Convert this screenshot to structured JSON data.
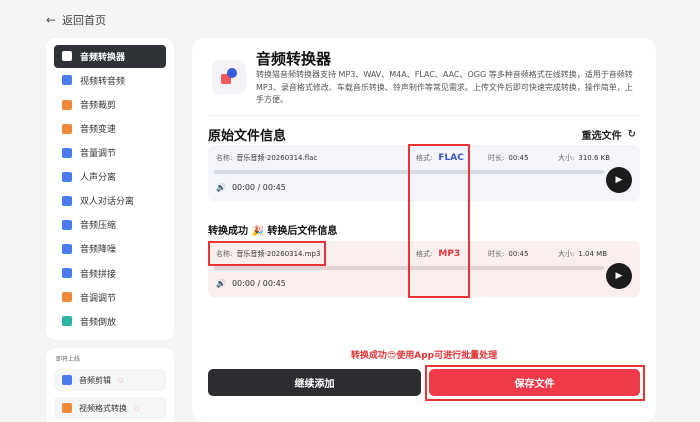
{
  "nav": {
    "back_label": "返回首页"
  },
  "sidebar": {
    "items": [
      {
        "label": "音频转换器",
        "icon": "audio-convert-icon",
        "color": "#3a5bd9",
        "active": true
      },
      {
        "label": "视频转音频",
        "icon": "video-audio-icon",
        "color": "#4a7cf0"
      },
      {
        "label": "音频裁剪",
        "icon": "scissors-icon",
        "color": "#f08a3a"
      },
      {
        "label": "音频变速",
        "icon": "speed-icon",
        "color": "#f08a3a"
      },
      {
        "label": "音量调节",
        "icon": "volume-icon",
        "color": "#4a7cf0"
      },
      {
        "label": "人声分离",
        "icon": "vocal-icon",
        "color": "#4a7cf0"
      },
      {
        "label": "双人对话分离",
        "icon": "dialog-icon",
        "color": "#4a7cf0"
      },
      {
        "label": "音频压缩",
        "icon": "compress-icon",
        "color": "#4a7cf0"
      },
      {
        "label": "音频降噪",
        "icon": "denoise-icon",
        "color": "#4a7cf0"
      },
      {
        "label": "音频拼接",
        "icon": "merge-icon",
        "color": "#4a7cf0"
      },
      {
        "label": "音调调节",
        "icon": "pitch-icon",
        "color": "#f08a3a"
      },
      {
        "label": "音频倒放",
        "icon": "reverse-icon",
        "color": "#2bb5a0"
      }
    ]
  },
  "coming_soon": {
    "title": "即将上线",
    "items": [
      {
        "label": "音频剪辑",
        "icon": "audio-edit-icon",
        "color": "#4a7cf0"
      },
      {
        "label": "视频格式转换",
        "icon": "video-format-icon",
        "color": "#f08a3a"
      }
    ]
  },
  "header": {
    "title": "音频转换器",
    "description": "转换猫音频转换器支持 MP3、WAV、M4A、FLAC、AAC、OGG 等多种音频格式在线转换，适用于音频转MP3、录音格式修改、车载音乐转换、铃声制作等常见需求。上传文件后即可快速完成转换，操作简单，上手方便。"
  },
  "original": {
    "section_title": "原始文件信息",
    "reselect_label": "重选文件",
    "name_label": "名称:",
    "name": "音乐音频-20260314.flac",
    "format_label": "格式:",
    "format": "FLAC",
    "duration_label": "时长:",
    "duration": "00:45",
    "size_label": "大小:",
    "size": "310.6 KB",
    "time_display": "00:00 / 00:45",
    "progress": 0
  },
  "converted": {
    "section_title": "转换成功 🎉 转换后文件信息",
    "name_label": "名称:",
    "name": "音乐音频-20260314.mp3",
    "format_label": "格式:",
    "format": "MP3",
    "duration_label": "时长:",
    "duration": "00:45",
    "size_label": "大小:",
    "size": "1.04 MB",
    "time_display": "00:00 / 00:45",
    "progress": 0
  },
  "footer": {
    "batch_hint": "转换成功😍使用App可进行批量处理",
    "continue_label": "继续添加",
    "save_label": "保存文件"
  },
  "colors": {
    "accent": "#e53535",
    "dark": "#2b2d31",
    "save": "#f03a4a"
  }
}
